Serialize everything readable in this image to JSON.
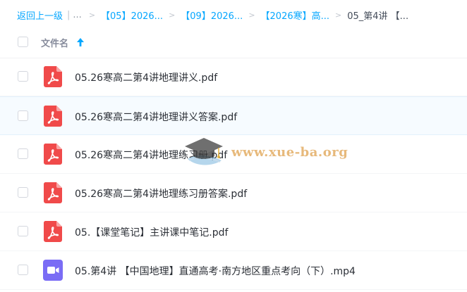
{
  "breadcrumb": {
    "back_label": "返回上一级",
    "pipe": "|",
    "ellipsis": "...",
    "separator": ">",
    "items": [
      "【05】2026...",
      "【09】2026...",
      "【2026寒】高..."
    ],
    "current": "05_第4讲 【..."
  },
  "header": {
    "column_label": "文件名",
    "sort_direction": "ascending"
  },
  "files": [
    {
      "name": "05.26寒高二第4讲地理讲义.pdf",
      "type": "pdf"
    },
    {
      "name": "05.26寒高二第4讲地理讲义答案.pdf",
      "type": "pdf"
    },
    {
      "name": "05.26寒高二第4讲地理练习册.pdf",
      "type": "pdf"
    },
    {
      "name": "05.26寒高二第4讲地理练习册答案.pdf",
      "type": "pdf"
    },
    {
      "name": "05.【课堂笔记】主讲课中笔记.pdf",
      "type": "pdf"
    },
    {
      "name": "05.第4讲 【中国地理】直通高考·南方地区重点考向（下）.mp4",
      "type": "video"
    }
  ],
  "watermark": {
    "text": "www.xue-ba.org"
  },
  "colors": {
    "link": "#06a7ff",
    "pdf_icon": "#f04a4a",
    "video_icon": "#7a6cf5",
    "hover_row": "#f6fbff"
  },
  "icons": {
    "sort": "arrow-up-icon",
    "pdf": "pdf-file-icon",
    "video": "video-file-icon",
    "watermark": "graduation-cap-icon"
  }
}
